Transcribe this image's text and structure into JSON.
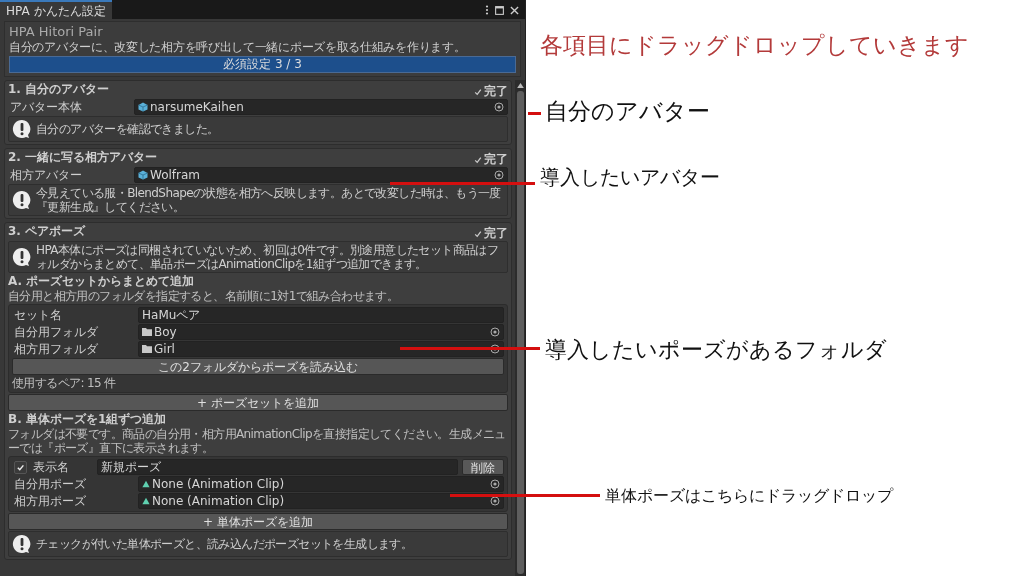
{
  "window": {
    "tab": "HPA かんたん設定",
    "title": "HPA Hitori Pair",
    "description": "自分のアバターに、改変した相方を呼び出して一緒にポーズを取る仕組みを作ります。",
    "progress": {
      "label": "必須設定 3 / 3",
      "level": 1
    }
  },
  "sections": [
    {
      "title": "1. 自分のアバター",
      "status": "完了",
      "items": [
        {
          "kind": "avatar",
          "label": "アバター本体",
          "value": "narsumeKaihen"
        },
        {
          "kind": "help",
          "text": "自分のアバターを確認できました。"
        }
      ]
    },
    {
      "title": "2. 一緒に写る相方アバター",
      "status": "完了",
      "items": [
        {
          "kind": "avatar",
          "label": "相方アバター",
          "value": "Wolfram"
        },
        {
          "kind": "help",
          "text": "今見えている服・BlendShapeの状態を相方へ反映します。あとで改変した時は、もう一度『更新生成』してください。"
        }
      ]
    },
    {
      "title": "3. ペアポーズ",
      "status": "完了",
      "items": [
        {
          "kind": "help",
          "text": "HPA本体にポーズは同梱されていないため、初回は0件です。別途用意したセット商品はフォルダからまとめて、単品ポーズはAnimationClipを1組ずつ追加できます。"
        },
        {
          "kind": "subheading",
          "text": "A. ポーズセットからまとめて追加"
        },
        {
          "kind": "caption",
          "text": "自分用と相方用のフォルダを指定すると、名前順に1対1で組み合わせます。"
        },
        {
          "kind": "group",
          "items": [
            {
              "kind": "text",
              "label": "セット名",
              "value": "HaMuペア"
            },
            {
              "kind": "folder",
              "label": "自分用フォルダ",
              "value": "Boy"
            },
            {
              "kind": "folder",
              "label": "相方用フォルダ",
              "value": "Girl"
            },
            {
              "kind": "button",
              "label": "この2フォルダからポーズを読み込む"
            },
            {
              "kind": "caption",
              "text": "使用するペア: 15 件"
            }
          ]
        },
        {
          "kind": "button",
          "label": "+ ポーズセットを追加"
        },
        {
          "kind": "subheading",
          "text": "B. 単体ポーズを1組ずつ追加"
        },
        {
          "kind": "caption",
          "text": "フォルダは不要です。商品の自分用・相方用AnimationClipを直接指定してください。生成メニューでは『ポーズ』直下に表示されます。"
        },
        {
          "kind": "group",
          "items": [
            {
              "kind": "check",
              "checked": true,
              "label": "表示名",
              "value": "新規ポーズ",
              "button": "削除"
            },
            {
              "kind": "clip",
              "label": "自分用ポーズ",
              "value": "None (Animation Clip)"
            },
            {
              "kind": "clip",
              "label": "相方用ポーズ",
              "value": "None (Animation Clip)"
            }
          ]
        },
        {
          "kind": "button",
          "label": "+ 単体ポーズを追加"
        },
        {
          "kind": "help",
          "text": "チェックが付いた単体ポーズと、読み込んだポーズセットを生成します。"
        }
      ]
    }
  ],
  "annotations": {
    "heading": "各項目にドラッグドロップしていきます",
    "callouts": [
      {
        "text": "自分のアバター"
      },
      {
        "text": "導入したいアバター"
      },
      {
        "text": "導入したいポーズがあるフォルダ"
      },
      {
        "text": "単体ポーズはこちらにドラッグドロップ"
      }
    ]
  }
}
